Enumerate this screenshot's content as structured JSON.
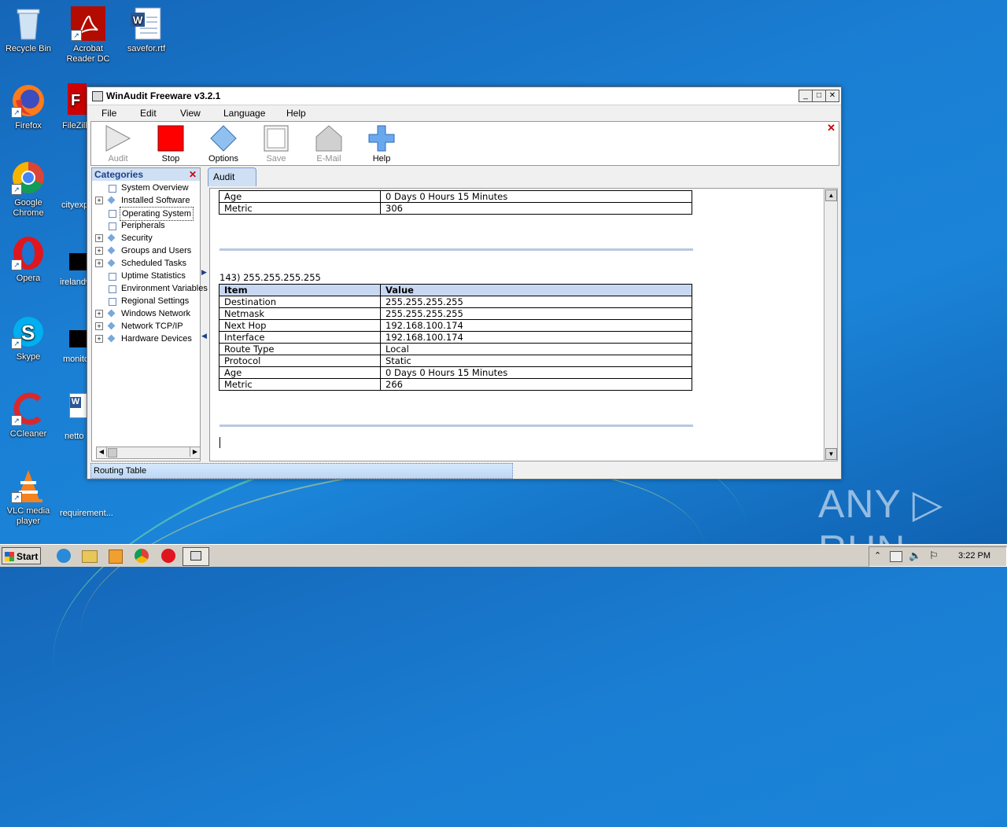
{
  "desktop": {
    "icons": [
      {
        "label": "Recycle Bin"
      },
      {
        "label": "Acrobat Reader DC"
      },
      {
        "label": "savefor.rtf"
      },
      {
        "label": "Firefox"
      },
      {
        "label": "FileZilla"
      },
      {
        "label": "Google Chrome"
      },
      {
        "label": "cityexp"
      },
      {
        "label": "Opera"
      },
      {
        "label": "irelandw"
      },
      {
        "label": "Skype"
      },
      {
        "label": "monito"
      },
      {
        "label": "CCleaner"
      },
      {
        "label": "netto"
      },
      {
        "label": "VLC media player"
      },
      {
        "label": "requirement..."
      }
    ],
    "watermark": "ANY ▷ RUN"
  },
  "window": {
    "title": "WinAudit Freeware v3.2.1",
    "menu": [
      "File",
      "Edit",
      "View",
      "Language",
      "Help"
    ],
    "toolbar": [
      {
        "label": "Audit",
        "icon": "play-triangle-icon",
        "enabled": false
      },
      {
        "label": "Stop",
        "icon": "red-square-icon",
        "enabled": true
      },
      {
        "label": "Options",
        "icon": "blue-diamond-icon",
        "enabled": true
      },
      {
        "label": "Save",
        "icon": "save-doc-icon",
        "enabled": false
      },
      {
        "label": "E-Mail",
        "icon": "house-envelope-icon",
        "enabled": false
      },
      {
        "label": "Help",
        "icon": "blue-plus-icon",
        "enabled": true
      }
    ],
    "categories": {
      "header": "Categories",
      "items": [
        {
          "label": "System Overview",
          "expandable": false,
          "icon": "page"
        },
        {
          "label": "Installed Software",
          "expandable": true,
          "icon": "diamond"
        },
        {
          "label": "Operating System",
          "expandable": false,
          "icon": "page",
          "selected": true
        },
        {
          "label": "Peripherals",
          "expandable": false,
          "icon": "page"
        },
        {
          "label": "Security",
          "expandable": true,
          "icon": "diamond"
        },
        {
          "label": "Groups and Users",
          "expandable": true,
          "icon": "diamond"
        },
        {
          "label": "Scheduled Tasks",
          "expandable": true,
          "icon": "diamond"
        },
        {
          "label": "Uptime Statistics",
          "expandable": false,
          "icon": "page"
        },
        {
          "label": "Environment Variables",
          "expandable": false,
          "icon": "page"
        },
        {
          "label": "Regional Settings",
          "expandable": false,
          "icon": "page"
        },
        {
          "label": "Windows Network",
          "expandable": true,
          "icon": "diamond"
        },
        {
          "label": "Network TCP/IP",
          "expandable": true,
          "icon": "diamond"
        },
        {
          "label": "Hardware Devices",
          "expandable": true,
          "icon": "diamond"
        }
      ]
    },
    "tab": "Audit",
    "top_rows": [
      [
        "Age",
        "0 Days 0 Hours 15 Minutes"
      ],
      [
        "Metric",
        "306"
      ]
    ],
    "route": {
      "title": "143) 255.255.255.255",
      "headers": [
        "Item",
        "Value"
      ],
      "rows": [
        [
          "Destination",
          "255.255.255.255"
        ],
        [
          "Netmask",
          "255.255.255.255"
        ],
        [
          "Next Hop",
          "192.168.100.174"
        ],
        [
          "Interface",
          "192.168.100.174"
        ],
        [
          "Route Type",
          "Local"
        ],
        [
          "Protocol",
          "Static"
        ],
        [
          "Age",
          "0 Days 0 Hours 15 Minutes"
        ],
        [
          "Metric",
          "266"
        ]
      ]
    },
    "status": "Routing Table"
  },
  "taskbar": {
    "start": "Start",
    "clock": "3:22 PM"
  }
}
